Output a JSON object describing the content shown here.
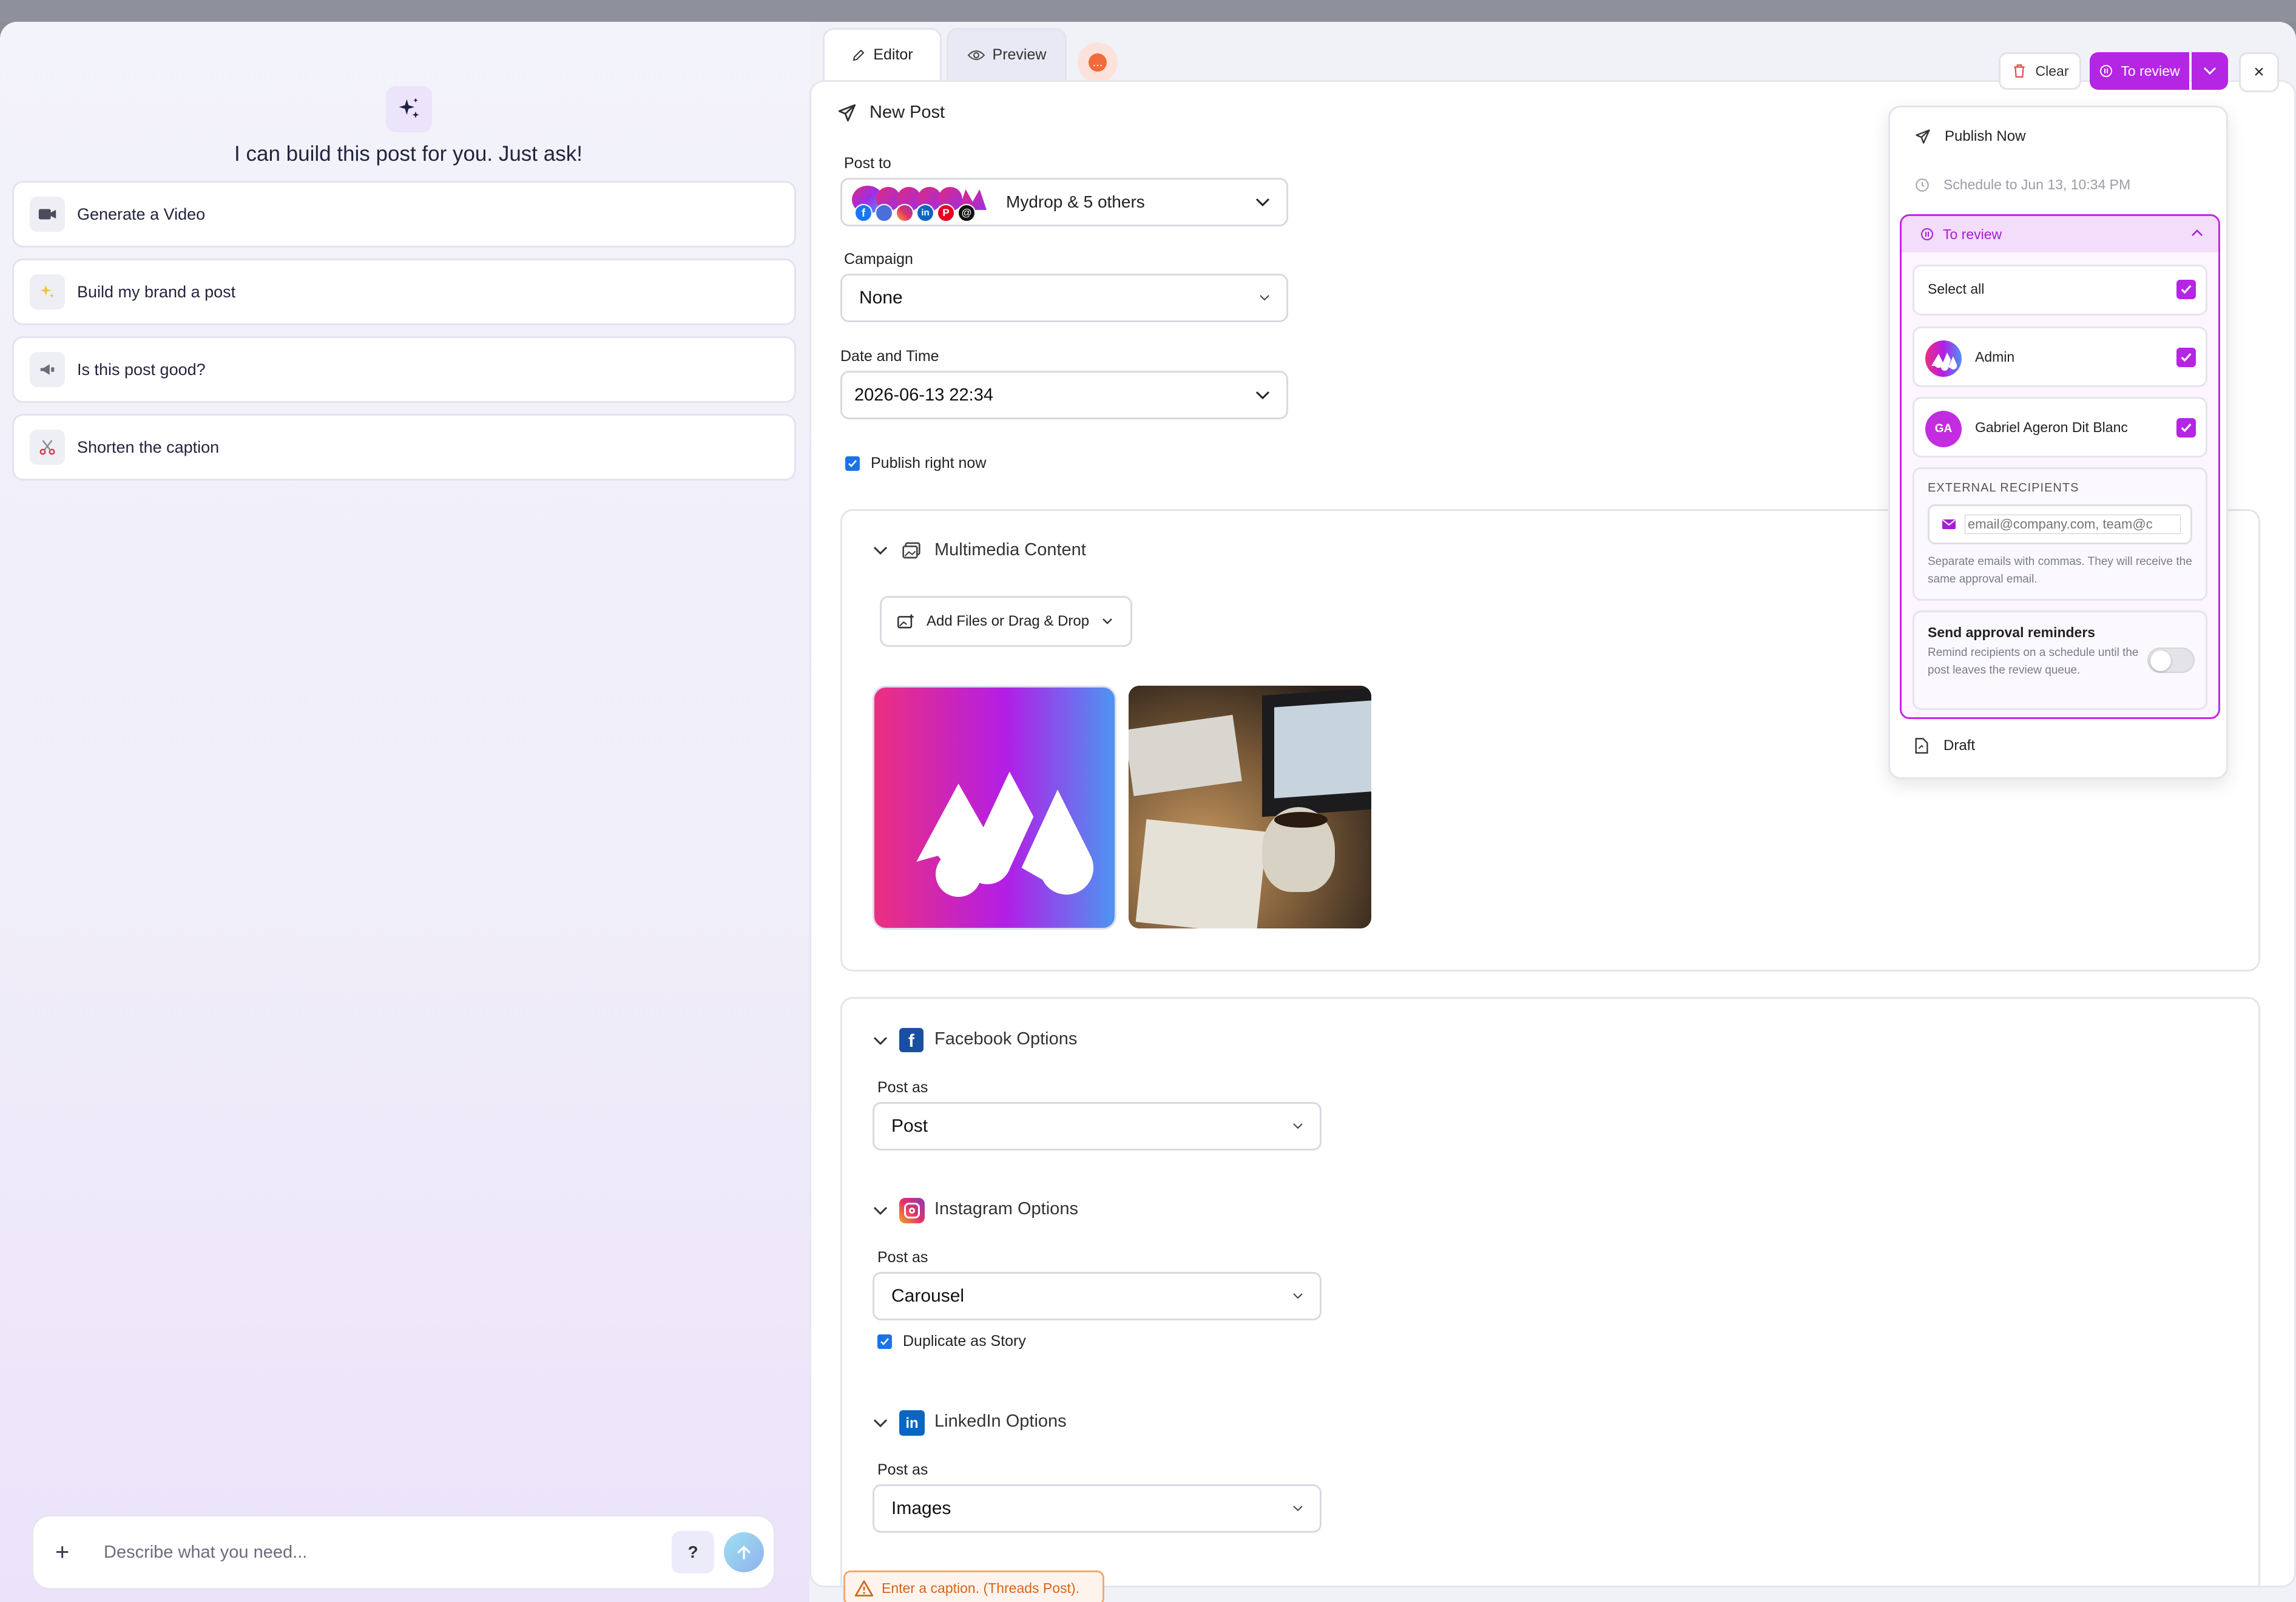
{
  "assistant": {
    "title": "I can build this post for you. Just ask!",
    "suggestions": [
      {
        "label": "Generate a Video",
        "icon": "video-camera-icon"
      },
      {
        "label": "Build my brand a post",
        "icon": "sparkles-icon"
      },
      {
        "label": "Is this post good?",
        "icon": "megaphone-icon"
      },
      {
        "label": "Shorten the caption",
        "icon": "scissors-icon"
      }
    ],
    "input_placeholder": "Describe what you need...",
    "help_label": "?"
  },
  "tabs": {
    "editor": "Editor",
    "preview": "Preview",
    "more": "..."
  },
  "toolbar": {
    "clear": "Clear",
    "to_review": "To review",
    "close": "×"
  },
  "editor": {
    "title": "New Post",
    "post_to": {
      "label": "Post to",
      "value": "Mydrop & 5 others"
    },
    "campaign": {
      "label": "Campaign",
      "value": "None"
    },
    "datetime": {
      "label": "Date and Time",
      "value": "2026-06-13 22:34"
    },
    "publish_now": {
      "label": "Publish right now",
      "checked": true
    },
    "multimedia": {
      "title": "Multimedia Content",
      "add_files": "Add Files or Drag & Drop"
    },
    "facebook": {
      "title": "Facebook Options",
      "post_as_label": "Post as",
      "post_as": "Post"
    },
    "instagram": {
      "title": "Instagram Options",
      "post_as_label": "Post as",
      "post_as": "Carousel",
      "duplicate_story": "Duplicate as Story"
    },
    "linkedin": {
      "title": "LinkedIn Options",
      "post_as_label": "Post as",
      "post_as": "Images"
    },
    "warning": "Enter a caption. (Threads Post)."
  },
  "dropdown": {
    "publish_now": "Publish Now",
    "schedule": "Schedule to Jun 13, 10:34 PM",
    "to_review": "To review",
    "select_all": "Select all",
    "reviewers": [
      {
        "name": "Admin",
        "initials": "",
        "checked": true
      },
      {
        "name": "Gabriel Ageron Dit Blanc",
        "initials": "GA",
        "checked": true
      }
    ],
    "external": {
      "title": "EXTERNAL RECIPIENTS",
      "placeholder": "email@company.com, team@c",
      "help": "Separate emails with commas. They will receive the same approval email."
    },
    "reminders": {
      "title": "Send approval reminders",
      "help": "Remind recipients on a schedule until the post leaves the review queue.",
      "enabled": false
    },
    "draft": "Draft"
  },
  "colors": {
    "accent": "#b525e4",
    "warning": "#d76419"
  }
}
